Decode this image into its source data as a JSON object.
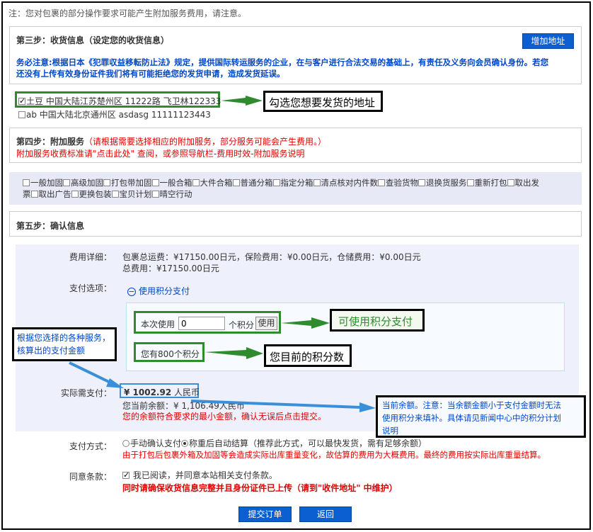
{
  "notice": "注：您对包裹的部分操作要求可能产生附加服务费用，请注意。",
  "step3": {
    "title": "第三步：收货信息（设定您的收货信息）",
    "add_address": "增加地址",
    "warning": "务必注意:根据日本《犯罪収益移転防止法》规定，提供国际转运服务的企业，在与客户进行合法交易的基础上，有责任及义务向会员确认身份。若您",
    "warning2": "还没有上传有效身份证件我们将有可能拒绝您的发货申请，造成发货延误。",
    "addresses": [
      {
        "text": "土豆 中国大陆江苏楚州区 11222路 飞卫林122333",
        "checked": true
      },
      {
        "text": "ab 中国大陆北京通州区 asdasg 11111123443",
        "checked": false
      }
    ],
    "callout": "勾选您想要发货的地址"
  },
  "step4": {
    "title": "第四步：附加服务",
    "title_note": "（请根据需要选择相应的附加服务，部分服务可能会产生费用。）",
    "fee_note": "附加服务收费标准请\"点击此处\" 查阅，或参照导航栏-费用时效-附加服务说明",
    "services_row1": [
      "一般加固",
      "高级加固",
      "打包带加固",
      "一般合箱",
      "大件合箱",
      "普通分箱",
      "指定分箱",
      "清点核对内件数",
      "查验货物",
      "退换货服务",
      "重新打包",
      "取出发"
    ],
    "services_row1_tail": "票",
    "services_row2": [
      "取出广告",
      "更换包装",
      "宝贝计划",
      "晴空行动"
    ]
  },
  "step5": {
    "title": "第五步：确认信息",
    "fee_label": "费用详细：",
    "fee_line1": "包裹总运费：¥17150.00日元，保险费用：¥0.00日元，仓储费用：¥0.00日元",
    "fee_line2": "总费用：¥17150.00日元",
    "pay_option_label": "支付选项：",
    "use_points": "使用积分支付",
    "use_prefix": "本次使用",
    "points_value": "0",
    "points_unit": "个积分",
    "use_button": "使用",
    "points_have": "您有800个积分",
    "callout_use": "可使用积分支付",
    "callout_points": "您目前的积分数",
    "callout_left": "根据您选择的各种服务，\n核算出的支付金额",
    "actual_label": "实际需支付：",
    "actual_amount": "¥ 1002.92",
    "actual_unit": "人民币",
    "balance": "您当前余额：¥ 1,106.49人民币",
    "balance_note": "您的余额符合要求的最小金额，确认无误后点击提交。",
    "callout_balance": "当前余额。注意：当余额金额小于支付金额时无法\n使用积分来填补。具体请见新闻中心中的积分计划\n说明",
    "pay_method_label": "支付方式：",
    "pay_manual": "手动确认支付",
    "pay_auto": "称重后自动结算（推荐此方式，可以最快发货，需有足够余额）",
    "pay_note": "由于打包后包裹外箱及加固等会造成实际出库重量变化，故估算的费用为大概费用。最终的费用按实际出库重量结算。",
    "agree_label": "同意条款：",
    "agree_text": "我已阅读，并同意本站相关支付条款。",
    "agree_warn": "同时请确保收货信息完整并且身份证件已上传（请到\"收件地址\" 中维护）",
    "submit": "提交订单",
    "back": "返回"
  },
  "colors": {
    "accent": "#0b5fd1",
    "warning": "#e00000",
    "callout_green": "#2e8b2e",
    "callout_blue": "#3a8fd8",
    "panel": "#eef0fb"
  }
}
